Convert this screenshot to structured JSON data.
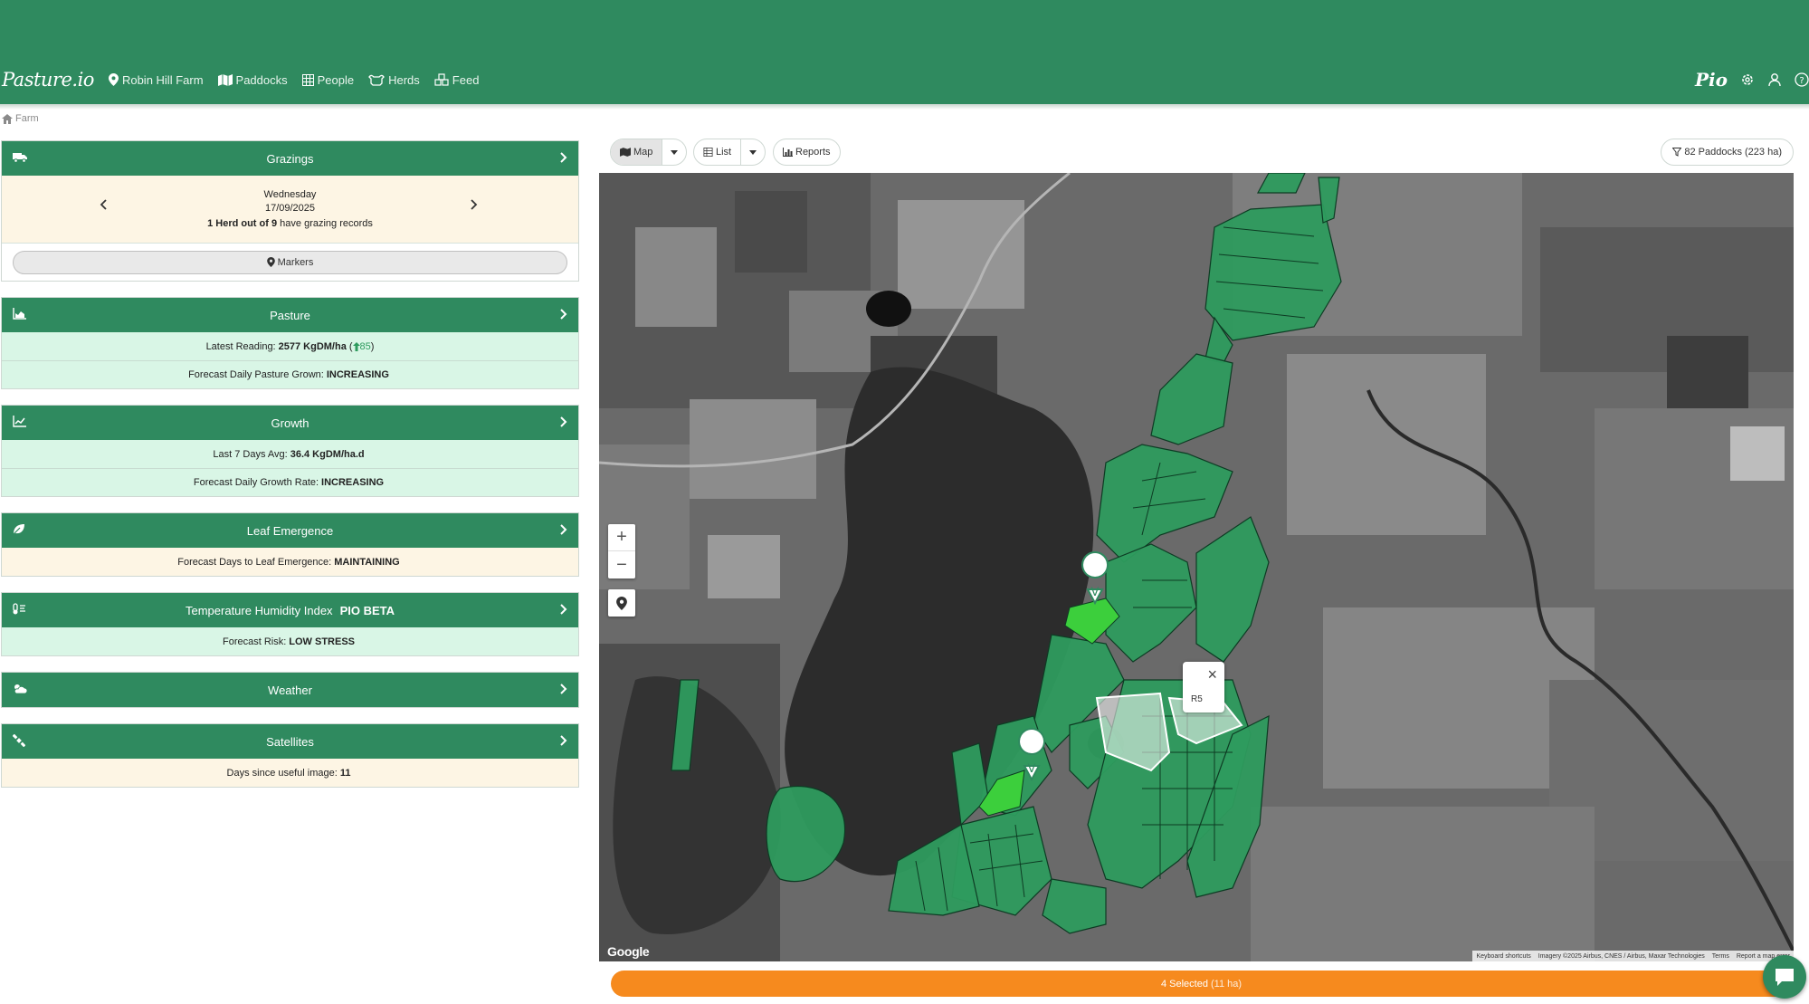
{
  "header": {
    "brand": "Pasture.io",
    "nav": [
      {
        "label": "Robin Hill Farm",
        "icon": "map-pin-icon"
      },
      {
        "label": "Paddocks",
        "icon": "map-icon"
      },
      {
        "label": "People",
        "icon": "table-icon"
      },
      {
        "label": "Herds",
        "icon": "cow-icon"
      },
      {
        "label": "Feed",
        "icon": "feed-icon"
      }
    ],
    "pio_logo": "Pio",
    "right_icons": [
      "gear-icon",
      "user-icon",
      "help-icon"
    ]
  },
  "breadcrumb": {
    "label": "Farm",
    "icon": "home-icon"
  },
  "sidebar": {
    "grazings": {
      "title": "Grazings",
      "day": "Wednesday",
      "date": "17/09/2025",
      "herd_prefix": "1 Herd out of",
      "herd_total": "9",
      "herd_suffix": "have grazing records",
      "markers_label": "Markers"
    },
    "pasture": {
      "title": "Pasture",
      "reading_label": "Latest Reading:",
      "reading_value": "2577 KgDM/ha",
      "reading_delta": "85",
      "forecast_label": "Forecast Daily Pasture Grown:",
      "forecast_value": "INCREASING"
    },
    "growth": {
      "title": "Growth",
      "avg_label": "Last 7 Days Avg:",
      "avg_value": "36.4 KgDM/ha.d",
      "forecast_label": "Forecast Daily Growth Rate:",
      "forecast_value": "INCREASING"
    },
    "leaf": {
      "title": "Leaf Emergence",
      "forecast_label": "Forecast Days to Leaf Emergence:",
      "forecast_value": "MAINTAINING"
    },
    "thi": {
      "title": "Temperature Humidity Index",
      "badge": "PIO BETA",
      "risk_label": "Forecast Risk:",
      "risk_value": "LOW STRESS"
    },
    "weather": {
      "title": "Weather"
    },
    "satellites": {
      "title": "Satellites",
      "days_label": "Days since useful image:",
      "days_value": "11"
    }
  },
  "map_toolbar": {
    "map_label": "Map",
    "list_label": "List",
    "reports_label": "Reports",
    "paddock_count": "82 Paddocks (223 ha)"
  },
  "map": {
    "popup_label": "R5",
    "google": "Google",
    "attribution": [
      "Keyboard shortcuts",
      "Imagery ©2025 Airbus, CNES / Airbus, Maxar Technologies",
      "Terms",
      "Report a map error"
    ],
    "zoom_in": "+",
    "zoom_out": "−"
  },
  "selection": {
    "label": "4 Selected",
    "area": "(11 ha)"
  },
  "colors": {
    "brand_green": "#2f8a5f",
    "paddock_green": "#2e9b5e",
    "selected_paddock": "#3ccf3c",
    "accent_orange": "#f68a1e",
    "cream": "#fdf5e4",
    "mint": "#d9f6e6"
  }
}
